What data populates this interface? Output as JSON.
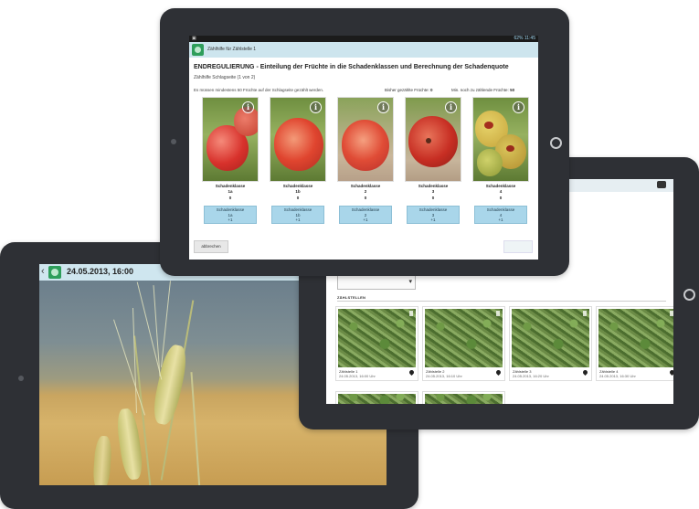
{
  "left_tablet": {
    "datetime": "24.05.2013, 16:00",
    "back_glyph": "‹"
  },
  "right_tablet": {
    "section_label": "ZÄHLSTELLEN",
    "dropdown_arrow": "▾",
    "thumbnails": [
      {
        "title": "Zählstelle 1",
        "date": "24.05.2013, 16:00 Uhr"
      },
      {
        "title": "Zählstelle 2",
        "date": "24.05.2013, 16:10 Uhr"
      },
      {
        "title": "Zählstelle 3",
        "date": "24.05.2013, 16:20 Uhr"
      },
      {
        "title": "Zählstelle 4",
        "date": "24.05.2013, 16:30 Uhr"
      }
    ]
  },
  "top_tablet": {
    "status_time": "11:45",
    "status_battery": "62%",
    "app_title": "Zählhilfe für Zählstelle 1",
    "heading": "ENDREGULIERUNG - Einteilung der Früchte in die Schadenklassen und Berechnung der Schadenquote",
    "subheading": "Zählhilfe Schlagseite (1 von 2)",
    "requirement": "Es müssen mindestens 50 Früchte auf der Schlagseite gezählt werden.",
    "counted_label": "Bisher gezählte Früchte:",
    "counted_value": "0",
    "remaining_label": "Min. noch zu zählende Früchte:",
    "remaining_value": "50",
    "info_glyph": "i",
    "classes": [
      {
        "label": "Schadenklasse",
        "code": "1a",
        "count": "0",
        "btn_label": "Schadenklasse",
        "btn_code": "1a",
        "btn_inc": "+1"
      },
      {
        "label": "Schadenklasse",
        "code": "1b",
        "count": "0",
        "btn_label": "Schadenklasse",
        "btn_code": "1b",
        "btn_inc": "+1"
      },
      {
        "label": "Schadenklasse",
        "code": "2",
        "count": "0",
        "btn_label": "Schadenklasse",
        "btn_code": "2",
        "btn_inc": "+1"
      },
      {
        "label": "Schadenklasse",
        "code": "3",
        "count": "0",
        "btn_label": "Schadenklasse",
        "btn_code": "3",
        "btn_inc": "+1"
      },
      {
        "label": "Schadenklasse",
        "code": "4",
        "count": "0",
        "btn_label": "Schadenklasse",
        "btn_code": "4",
        "btn_inc": "+1"
      }
    ],
    "cancel_label": "abbrechen"
  }
}
